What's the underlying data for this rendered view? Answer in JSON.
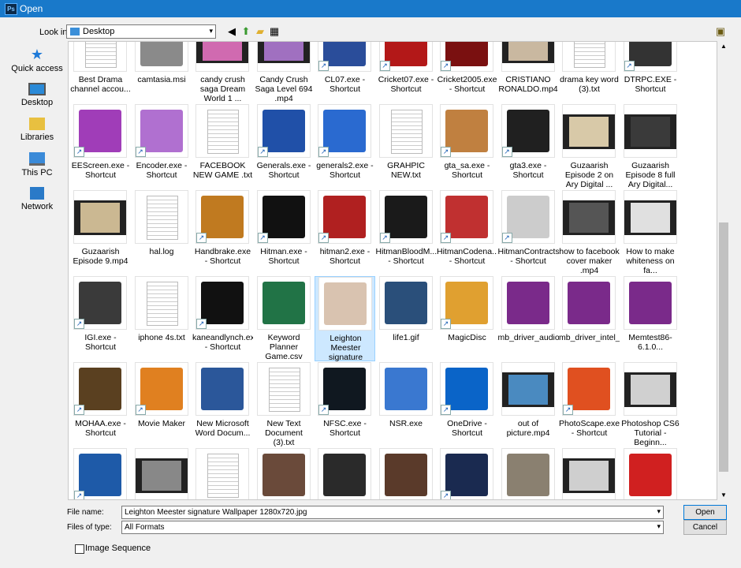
{
  "window": {
    "title": "Open"
  },
  "toolbar": {
    "lookin_label": "Look in:",
    "lookin_value": "Desktop"
  },
  "places": [
    {
      "label": "Quick access",
      "icon": "star-icon"
    },
    {
      "label": "Desktop",
      "icon": "desktop-icon"
    },
    {
      "label": "Libraries",
      "icon": "library-icon"
    },
    {
      "label": "This PC",
      "icon": "computer-icon"
    },
    {
      "label": "Network",
      "icon": "network-icon"
    }
  ],
  "files": [
    {
      "name": "Best Drama channel accou...",
      "kind": "doc"
    },
    {
      "name": "camtasia.msi",
      "kind": "app",
      "color": "#8a8a8a"
    },
    {
      "name": "candy crush saga Dream World 1 ...",
      "kind": "video",
      "color": "#d06ab0"
    },
    {
      "name": "Candy Crush Saga Level 694 .mp4",
      "kind": "video",
      "color": "#a070c0"
    },
    {
      "name": "CL07.exe - Shortcut",
      "kind": "app",
      "color": "#2a4d9a",
      "shortcut": true
    },
    {
      "name": "Cricket07.exe - Shortcut",
      "kind": "app",
      "color": "#b31818",
      "shortcut": true
    },
    {
      "name": "Cricket2005.exe - Shortcut",
      "kind": "app",
      "color": "#7a1010",
      "shortcut": true
    },
    {
      "name": "CRISTIANO RONALDO.mp4",
      "kind": "video",
      "color": "#c9b8a0"
    },
    {
      "name": "drama key word (3).txt",
      "kind": "doc"
    },
    {
      "name": "DTRPC.EXE - Shortcut",
      "kind": "app",
      "color": "#333333",
      "shortcut": true
    },
    {
      "name": "EEScreen.exe - Shortcut",
      "kind": "app",
      "color": "#a03db8",
      "shortcut": true
    },
    {
      "name": "Encoder.exe - Shortcut",
      "kind": "app",
      "color": "#b070d0",
      "shortcut": true
    },
    {
      "name": "FACEBOOK NEW GAME .txt",
      "kind": "doc"
    },
    {
      "name": "Generals.exe - Shortcut",
      "kind": "app",
      "color": "#2050a8",
      "shortcut": true
    },
    {
      "name": "generals2.exe - Shortcut",
      "kind": "app",
      "color": "#2a6ad0",
      "shortcut": true
    },
    {
      "name": "GRAHPIC NEW.txt",
      "kind": "doc"
    },
    {
      "name": "gta_sa.exe - Shortcut",
      "kind": "app",
      "color": "#c08040",
      "shortcut": true
    },
    {
      "name": "gta3.exe - Shortcut",
      "kind": "app",
      "color": "#202020",
      "shortcut": true
    },
    {
      "name": "Guzaarish Episode 2 on Ary Digital ...",
      "kind": "video",
      "color": "#d8c9a8"
    },
    {
      "name": "Guzaarish Episode 8 full Ary Digital...",
      "kind": "video",
      "color": "#3a3a3a"
    },
    {
      "name": "Guzaarish Episode 9.mp4",
      "kind": "video",
      "color": "#cbb892"
    },
    {
      "name": "hal.log",
      "kind": "doc"
    },
    {
      "name": "Handbrake.exe - Shortcut",
      "kind": "app",
      "color": "#c07a20",
      "shortcut": true
    },
    {
      "name": "Hitman.exe - Shortcut",
      "kind": "app",
      "color": "#111111",
      "shortcut": true
    },
    {
      "name": "hitman2.exe - Shortcut",
      "kind": "app",
      "color": "#b02020",
      "shortcut": true
    },
    {
      "name": "HitmanBloodM... - Shortcut",
      "kind": "app",
      "color": "#1a1a1a",
      "shortcut": true
    },
    {
      "name": "HitmanCodena... - Shortcut",
      "kind": "app",
      "color": "#c03030",
      "shortcut": true
    },
    {
      "name": "HitmanContracts... - Shortcut",
      "kind": "app",
      "color": "#cccccc",
      "shortcut": true
    },
    {
      "name": "how to facebook cover maker .mp4",
      "kind": "video",
      "color": "#555555"
    },
    {
      "name": "How to make whiteness on fa...",
      "kind": "video",
      "color": "#e0e0e0"
    },
    {
      "name": "IGI.exe - Shortcut",
      "kind": "app",
      "color": "#3a3a3a",
      "shortcut": true
    },
    {
      "name": "iphone 4s.txt",
      "kind": "doc"
    },
    {
      "name": "kaneandlynch.exe - Shortcut",
      "kind": "app",
      "color": "#111111",
      "shortcut": true
    },
    {
      "name": "Keyword Planner Game.csv",
      "kind": "app",
      "color": "#217346"
    },
    {
      "name": "Leighton Meester signature Wallpaper 1280x720.jpg",
      "kind": "image",
      "color": "#d9c3b0",
      "selected": true
    },
    {
      "name": "life1.gif",
      "kind": "image",
      "color": "#2a4f7a"
    },
    {
      "name": "MagicDisc",
      "kind": "app",
      "color": "#e0a030",
      "shortcut": true
    },
    {
      "name": "mb_driver_audio...",
      "kind": "app",
      "color": "#7a2a8a"
    },
    {
      "name": "mb_driver_intel_...",
      "kind": "app",
      "color": "#7a2a8a"
    },
    {
      "name": "Memtest86-6.1.0...",
      "kind": "app",
      "color": "#7a2a8a"
    },
    {
      "name": "MOHAA.exe - Shortcut",
      "kind": "app",
      "color": "#5a4020",
      "shortcut": true
    },
    {
      "name": "Movie Maker",
      "kind": "app",
      "color": "#e08020",
      "shortcut": true
    },
    {
      "name": "New Microsoft Word Docum...",
      "kind": "app",
      "color": "#2b579a"
    },
    {
      "name": "New Text Document (3).txt",
      "kind": "doc"
    },
    {
      "name": "NFSC.exe - Shortcut",
      "kind": "app",
      "color": "#101820",
      "shortcut": true
    },
    {
      "name": "NSR.exe",
      "kind": "app",
      "color": "#3a78d0"
    },
    {
      "name": "OneDrive - Shortcut",
      "kind": "app",
      "color": "#0a64c8",
      "shortcut": true
    },
    {
      "name": "out of picture.mp4",
      "kind": "video",
      "color": "#4a8ac0"
    },
    {
      "name": "PhotoScape.exe - Shortcut",
      "kind": "app",
      "color": "#e05020",
      "shortcut": true
    },
    {
      "name": "Photoshop CS6 Tutorial - Beginn...",
      "kind": "video",
      "color": "#d0d0d0"
    },
    {
      "name": "",
      "kind": "app",
      "color": "#1e5aa8",
      "shortcut": true
    },
    {
      "name": "",
      "kind": "video",
      "color": "#888888"
    },
    {
      "name": "",
      "kind": "doc"
    },
    {
      "name": "",
      "kind": "image",
      "color": "#6a4a3a"
    },
    {
      "name": "",
      "kind": "image",
      "color": "#2a2a2a"
    },
    {
      "name": "",
      "kind": "image",
      "color": "#5a3a2a"
    },
    {
      "name": "",
      "kind": "app",
      "color": "#1a2a50",
      "shortcut": true
    },
    {
      "name": "",
      "kind": "image",
      "color": "#8a8070"
    },
    {
      "name": "",
      "kind": "video",
      "color": "#cfcfcf"
    },
    {
      "name": "",
      "kind": "app",
      "color": "#d02020"
    }
  ],
  "bottom": {
    "filename_label": "File name:",
    "filename_value": "Leighton Meester signature Wallpaper 1280x720.jpg",
    "filetype_label": "Files of type:",
    "filetype_value": "All Formats",
    "open_label": "Open",
    "cancel_label": "Cancel",
    "image_sequence_label": "Image Sequence"
  }
}
